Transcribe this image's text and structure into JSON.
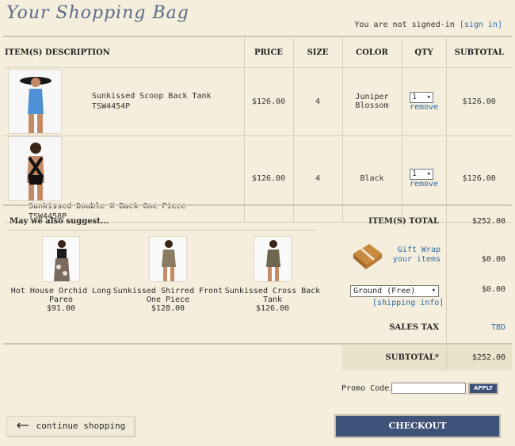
{
  "page": {
    "title": "Your Shopping Bag"
  },
  "auth": {
    "status": "You are not signed-in",
    "signin_link": "[sign in]"
  },
  "table": {
    "headers": {
      "description": "ITEM(S) DESCRIPTION",
      "price": "PRICE",
      "size": "SIZE",
      "color": "COLOR",
      "qty": "QTY",
      "subtotal": "SUBTOTAL"
    },
    "items": [
      {
        "name": "Sunkissed Scoop Back Tank",
        "sku": "TSW4454P",
        "price": "$126.00",
        "size": "4",
        "color_line1": "Juniper",
        "color_line2": "Blossom",
        "qty": "1",
        "remove": "remove",
        "subtotal": "$126.00",
        "swatch": "#4f8fd3"
      },
      {
        "name": "Sunkissed Double X Back One Piece",
        "sku": "TSW4458P",
        "price": "$126.00",
        "size": "4",
        "color_line1": "Black",
        "color_line2": "",
        "qty": "1",
        "remove": "remove",
        "subtotal": "$126.00",
        "swatch": "#1a1a1a"
      }
    ]
  },
  "suggestions": {
    "title": "May we also suggest...",
    "items": [
      {
        "name_line1": "Hot House Orchid Long",
        "name_line2": "Pareo",
        "price": "$91.00"
      },
      {
        "name_line1": "Sunkissed Shirred Front",
        "name_line2": "One Piece",
        "price": "$128.00"
      },
      {
        "name_line1": "Sunkissed Cross Back",
        "name_line2": "Tank",
        "price": "$126.00"
      }
    ]
  },
  "totals": {
    "items_total_label": "ITEM(S) TOTAL",
    "items_total": "$252.00",
    "gift_wrap_line1": "Gift Wrap",
    "gift_wrap_line2": "your items",
    "gift_wrap_value": "$0.00",
    "shipping_option": "Ground (Free)",
    "shipping_info": "[shipping info]",
    "shipping_value": "$0.00",
    "sales_tax_label": "SALES TAX",
    "sales_tax_value": "TBD",
    "subtotal_label": "SUBTOTAL*",
    "subtotal_value": "$252.00"
  },
  "promo": {
    "label": "Promo Code:",
    "value": "",
    "apply": "APPLY"
  },
  "actions": {
    "continue": "continue shopping",
    "checkout": "CHECKOUT"
  },
  "colors": {
    "accent": "#3f5378",
    "link": "#2b6aa8",
    "background": "#f5eedc"
  }
}
